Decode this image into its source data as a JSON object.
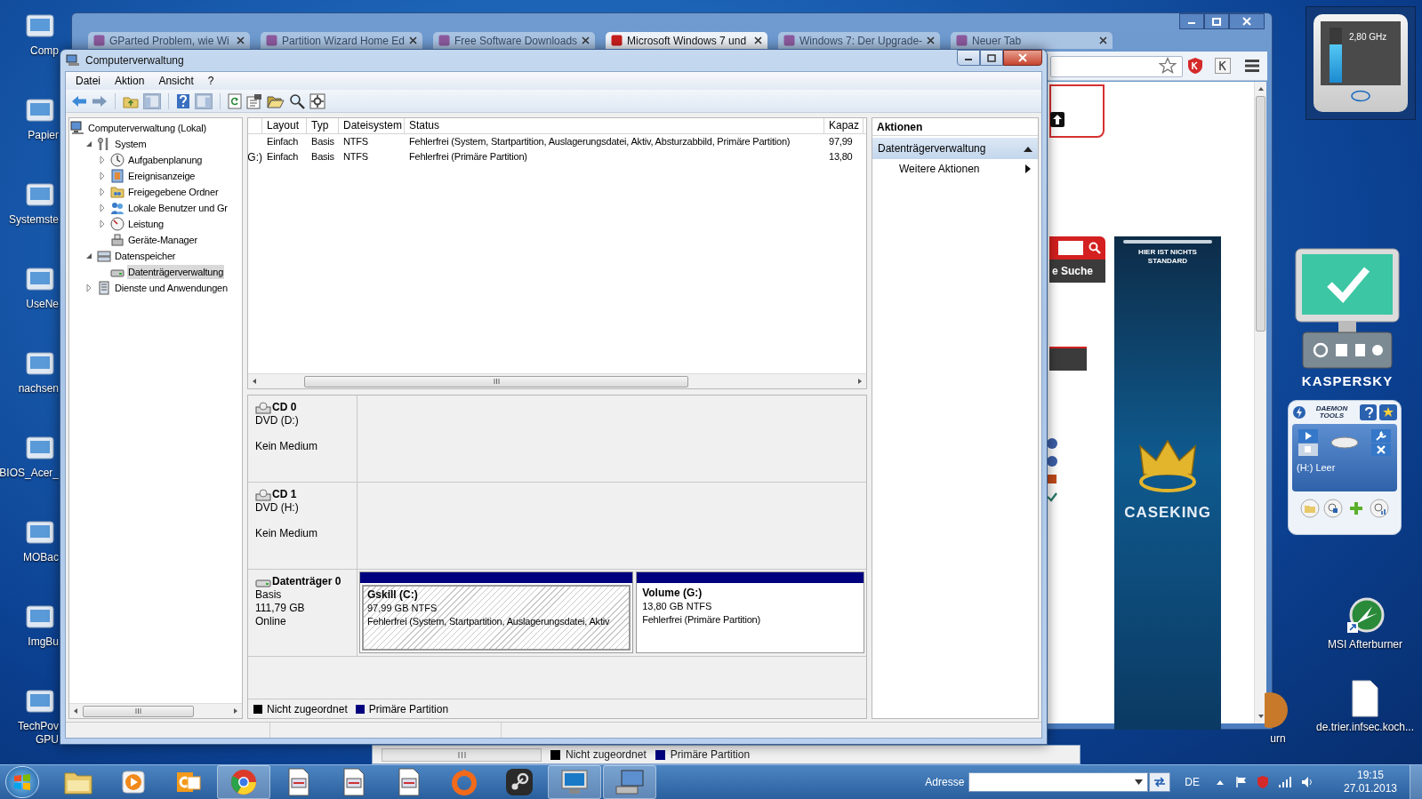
{
  "desktop_icons": [
    {
      "label": "Comp"
    },
    {
      "label": "Papier"
    },
    {
      "label": "Systemste"
    },
    {
      "label": "UseNe"
    },
    {
      "label": "nachsen"
    },
    {
      "label": "BIOS_Acer_"
    },
    {
      "label": "MOBac"
    },
    {
      "label": "ImgBu"
    },
    {
      "label": "TechPov GPU"
    }
  ],
  "browser": {
    "tabs": [
      {
        "label": "GParted Problem, wie Wi",
        "selected": false
      },
      {
        "label": "Partition Wizard Home Ed",
        "selected": false
      },
      {
        "label": "Free Software Downloads",
        "selected": false
      },
      {
        "label": "Microsoft Windows 7 und",
        "selected": true
      },
      {
        "label": "Windows 7: Der Upgrade-",
        "selected": false
      },
      {
        "label": "Neuer Tab",
        "selected": false
      }
    ],
    "search_button": "e Suche",
    "ad": {
      "tagline": "HIER IST NICHTS STANDARD",
      "brand": "CASEKING"
    }
  },
  "background_window": {
    "legend": [
      {
        "label": "Nicht zugeordnet",
        "color": "#000000"
      },
      {
        "label": "Primäre Partition",
        "color": "#00007f"
      }
    ]
  },
  "window": {
    "title": "Computerverwaltung",
    "menu": [
      "Datei",
      "Aktion",
      "Ansicht",
      "?"
    ],
    "tree": [
      {
        "label": "Computerverwaltung (Lokal)",
        "kind": "computer",
        "selected": false,
        "children": [
          {
            "label": "System",
            "kind": "tools",
            "expanded": true,
            "selected": false,
            "children": [
              {
                "label": "Aufgabenplanung",
                "kind": "clock",
                "expanded": false,
                "selected": false
              },
              {
                "label": "Ereignisanzeige",
                "kind": "event",
                "expanded": false,
                "selected": false
              },
              {
                "label": "Freigegebene Ordner",
                "kind": "folder",
                "expanded": false,
                "selected": false
              },
              {
                "label": "Lokale Benutzer und Gr",
                "kind": "users",
                "expanded": false,
                "selected": false
              },
              {
                "label": "Leistung",
                "kind": "performance",
                "expanded": false,
                "selected": false
              },
              {
                "label": "Geräte-Manager",
                "kind": "device",
                "selected": false
              }
            ]
          },
          {
            "label": "Datenspeicher",
            "kind": "storage",
            "expanded": true,
            "selected": false,
            "children": [
              {
                "label": "Datenträgerverwaltung",
                "kind": "disk",
                "selected": true
              }
            ]
          },
          {
            "label": "Dienste und Anwendungen",
            "kind": "services",
            "expanded": false,
            "selected": false
          }
        ]
      }
    ],
    "volume_list": {
      "columns": [
        "Layout",
        "Typ",
        "Dateisystem",
        "Status",
        "Kapaz"
      ],
      "rows": [
        {
          "cells": [
            "Einfach",
            "Basis",
            "NTFS",
            "Fehlerfrei (System, Startpartition, Auslagerungsdatei, Aktiv, Absturzabbild, Primäre Partition)",
            "97,99"
          ]
        },
        {
          "column_1": "G:)",
          "cells": [
            "Einfach",
            "Basis",
            "NTFS",
            "Fehlerfrei (Primäre Partition)",
            "13,80"
          ]
        }
      ]
    },
    "disks": [
      {
        "kind": "cdrom",
        "name": "CD 0",
        "type": "DVD (D:)",
        "status": "Kein Medium"
      },
      {
        "kind": "cdrom",
        "name": "CD 1",
        "type": "DVD (H:)",
        "status": "Kein Medium"
      },
      {
        "kind": "disk",
        "name": "Datenträger 0",
        "type": "Basis",
        "size": "111,79 GB",
        "status": "Online",
        "partitions": [
          {
            "name": "Gskill  (C:)",
            "size": "97,99 GB NTFS",
            "status": "Fehlerfrei (System, Startpartition, Auslagerungsdatei, Aktiv",
            "selected": true
          },
          {
            "name": "Volume  (G:)",
            "size": "13,80 GB NTFS",
            "status": "Fehlerfrei (Primäre Partition)",
            "selected": false
          }
        ]
      }
    ],
    "legend": [
      {
        "label": "Nicht zugeordnet",
        "color": "#000000"
      },
      {
        "label": "Primäre Partition",
        "color": "#00007f"
      }
    ],
    "actions": {
      "title": "Aktionen",
      "section": {
        "label": "Datenträgerverwaltung",
        "expanded": true
      },
      "items": [
        {
          "label": "Weitere Aktionen"
        }
      ]
    }
  },
  "gadgets": {
    "cpu": {
      "reading": "2,80 GHz",
      "level": 0.7
    },
    "kaspersky": {
      "brand": "KASPERSKY"
    },
    "daemon_tools": {
      "brand": "DAEMON TOOLS",
      "drive": "(H:) Leer"
    }
  },
  "desktop_icons_right": [
    {
      "label": "MSI Afterburner"
    },
    {
      "label": "urn"
    },
    {
      "label": "de.trier.infsec.koch..."
    }
  ],
  "taskbar": {
    "apps": [
      {
        "kind": "explorer",
        "active": false
      },
      {
        "kind": "media-player",
        "active": false
      },
      {
        "kind": "outlook",
        "active": false
      },
      {
        "kind": "chrome",
        "active": true
      },
      {
        "kind": "document",
        "active": false
      },
      {
        "kind": "document",
        "active": false
      },
      {
        "kind": "document",
        "active": false
      },
      {
        "kind": "origin",
        "active": false
      },
      {
        "kind": "steam",
        "active": false
      },
      {
        "kind": "monitor",
        "active": true
      },
      {
        "kind": "computer-management",
        "active": true
      }
    ],
    "address_label": "Adresse",
    "language": "DE",
    "time": "19:15",
    "date": "27.01.2013"
  }
}
